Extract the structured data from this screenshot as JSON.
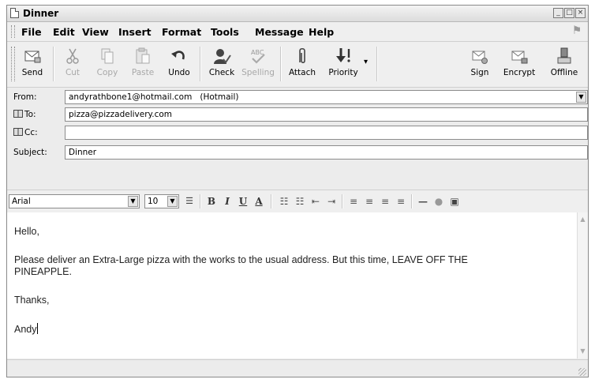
{
  "window": {
    "title": "Dinner"
  },
  "menu": [
    "File",
    "Edit",
    "View",
    "Insert",
    "Format",
    "Tools",
    "Message",
    "Help"
  ],
  "toolbar": {
    "send": "Send",
    "cut": "Cut",
    "copy": "Copy",
    "paste": "Paste",
    "undo": "Undo",
    "check": "Check",
    "spelling": "Spelling",
    "attach": "Attach",
    "priority": "Priority",
    "sign": "Sign",
    "encrypt": "Encrypt",
    "offline": "Offline"
  },
  "header": {
    "from_label": "From:",
    "from_value": "andyrathbone1@hotmail.com   (Hotmail)",
    "to_label": "To:",
    "to_value": "pizza@pizzadelivery.com",
    "cc_label": "Cc:",
    "cc_value": "",
    "subject_label": "Subject:",
    "subject_value": "Dinner"
  },
  "format": {
    "font": "Arial",
    "size": "10"
  },
  "body": {
    "line1": "Hello,",
    "line2": "Please deliver an Extra-Large pizza with the works to the usual address. But this time, LEAVE OFF THE",
    "line3": "PINEAPPLE.",
    "line4": "Thanks,",
    "line5": "Andy"
  }
}
